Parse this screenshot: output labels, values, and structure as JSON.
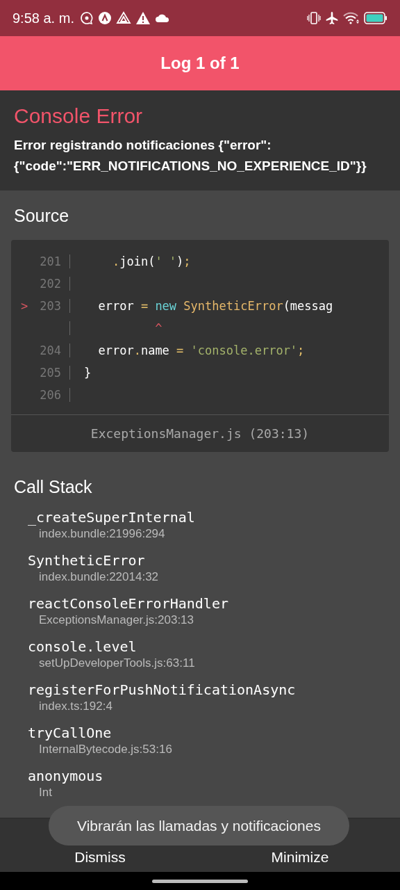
{
  "status_bar": {
    "time": "9:58 a. m."
  },
  "header": {
    "title": "Log 1 of 1"
  },
  "error": {
    "title": "Console Error",
    "message": "Error registrando notificaciones {\"error\":{\"code\":\"ERR_NOTIFICATIONS_NO_EXPERIENCE_ID\"}}"
  },
  "source": {
    "title": "Source",
    "lines": [
      {
        "number": "201",
        "segments": [
          {
            "text": "    .",
            "kind": "punct"
          },
          {
            "text": "join(",
            "kind": "plain"
          },
          {
            "text": "' '",
            "kind": "string"
          },
          {
            "text": ")",
            "kind": "plain"
          },
          {
            "text": ";",
            "kind": "punct"
          }
        ]
      },
      {
        "number": "202"
      },
      {
        "number": "203",
        "marker": ">",
        "segments": [
          {
            "text": "  error ",
            "kind": "plain"
          },
          {
            "text": "=",
            "kind": "punct"
          },
          {
            "text": " new",
            "kind": "keyword"
          },
          {
            "text": " SyntheticError",
            "kind": "type"
          },
          {
            "text": "(messag",
            "kind": "plain"
          }
        ]
      },
      {
        "segments": [
          {
            "text": "          ^",
            "kind": "caret"
          }
        ]
      },
      {
        "number": "204",
        "segments": [
          {
            "text": "  error",
            "kind": "plain"
          },
          {
            "text": ".",
            "kind": "punct"
          },
          {
            "text": "name ",
            "kind": "plain"
          },
          {
            "text": "=",
            "kind": "punct"
          },
          {
            "text": " 'console.error'",
            "kind": "string"
          },
          {
            "text": ";",
            "kind": "punct"
          }
        ]
      },
      {
        "number": "205",
        "segments": [
          {
            "text": "}",
            "kind": "plain"
          }
        ]
      },
      {
        "number": "206"
      }
    ],
    "location": "ExceptionsManager.js (203:13)"
  },
  "call_stack": {
    "title": "Call Stack",
    "frames": [
      {
        "method": "_createSuperInternal",
        "file": "index.bundle:21996:294"
      },
      {
        "method": "SyntheticError",
        "file": "index.bundle:22014:32"
      },
      {
        "method": "reactConsoleErrorHandler",
        "file": "ExceptionsManager.js:203:13"
      },
      {
        "method": "console.level",
        "file": "setUpDeveloperTools.js:63:11"
      },
      {
        "method": "registerForPushNotificationAsync",
        "file": "index.ts:192:4"
      },
      {
        "method": "tryCallOne",
        "file": "InternalBytecode.js:53:16"
      },
      {
        "method": "anonymous",
        "file": "Int"
      }
    ]
  },
  "footer": {
    "buttons": [
      "Dismiss",
      "Minimize"
    ]
  },
  "toast": {
    "text": "Vibrarán las llamadas y notificaciones"
  }
}
